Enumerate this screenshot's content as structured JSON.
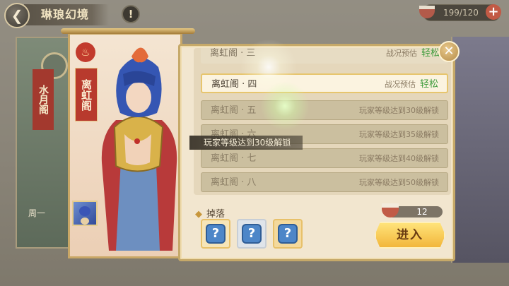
{
  "header": {
    "title": "琳琅幻境",
    "info_icon": "exclamation-icon",
    "stamina": "199/120",
    "stamina_plus": "+"
  },
  "background": {
    "left_banner_name": "水月阁",
    "left_banner_week": "周一"
  },
  "hero": {
    "name": "离虹阁"
  },
  "tooltip": "玩家等级达到30级解锁",
  "levels": [
    {
      "name": "离虹阁 · 三",
      "status": "战况预估",
      "difficulty": "轻松",
      "state": "partial"
    },
    {
      "name": "离虹阁 · 四",
      "status": "战况预估",
      "difficulty": "轻松",
      "state": "active"
    },
    {
      "name": "离虹阁 · 五",
      "status": "玩家等级达到30级解锁",
      "state": "locked"
    },
    {
      "name": "离虹阁 · 六",
      "status": "玩家等级达到35级解锁",
      "state": "locked"
    },
    {
      "name": "离虹阁 · 七",
      "status": "玩家等级达到40级解锁",
      "state": "locked"
    },
    {
      "name": "离虹阁 · 八",
      "status": "玩家等级达到50级解锁",
      "state": "locked"
    }
  ],
  "drops": {
    "label": "掉落",
    "items": [
      {
        "icon": "mystery-item-icon",
        "glyph": "?"
      },
      {
        "icon": "mystery-item-icon",
        "glyph": "?"
      },
      {
        "icon": "mystery-item-icon",
        "glyph": "?"
      }
    ]
  },
  "cost": "12",
  "enter_label": "进入",
  "close_glyph": "✕",
  "back_glyph": "❮",
  "colors": {
    "accent_gold": "#e7c56d",
    "easy_green": "#3c9b3a",
    "banner_red": "#b83a2d"
  }
}
